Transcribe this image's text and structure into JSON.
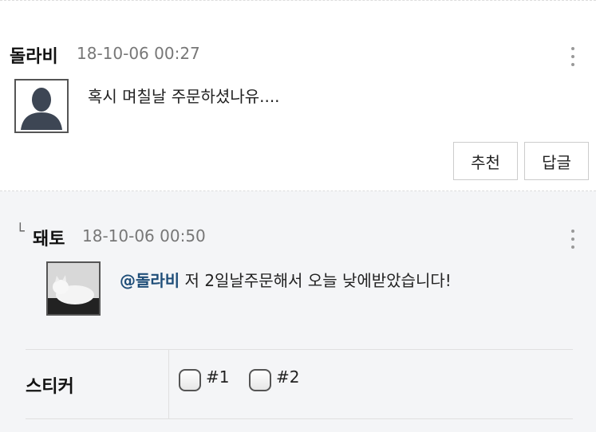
{
  "comments": [
    {
      "author": "돌라비",
      "date": "18-10-06 00:27",
      "text": "혹시 며칠날 주문하셨나유....",
      "avatar": "default-person-icon",
      "buttons": {
        "recommend": "추천",
        "reply": "답글"
      }
    },
    {
      "reply_marker": "└",
      "author": "돼토",
      "date": "18-10-06 00:50",
      "mention": "@돌라비",
      "text": " 저 2일날주문해서 오늘 낮에받았습니다!",
      "avatar": "white-cat-photo"
    }
  ],
  "sticker": {
    "label": "스티커",
    "options": [
      {
        "label": "#1",
        "checked": false
      },
      {
        "label": "#2",
        "checked": false
      }
    ]
  },
  "colors": {
    "reply_background": "#f4f5f7",
    "mention": "#1f4e79"
  }
}
